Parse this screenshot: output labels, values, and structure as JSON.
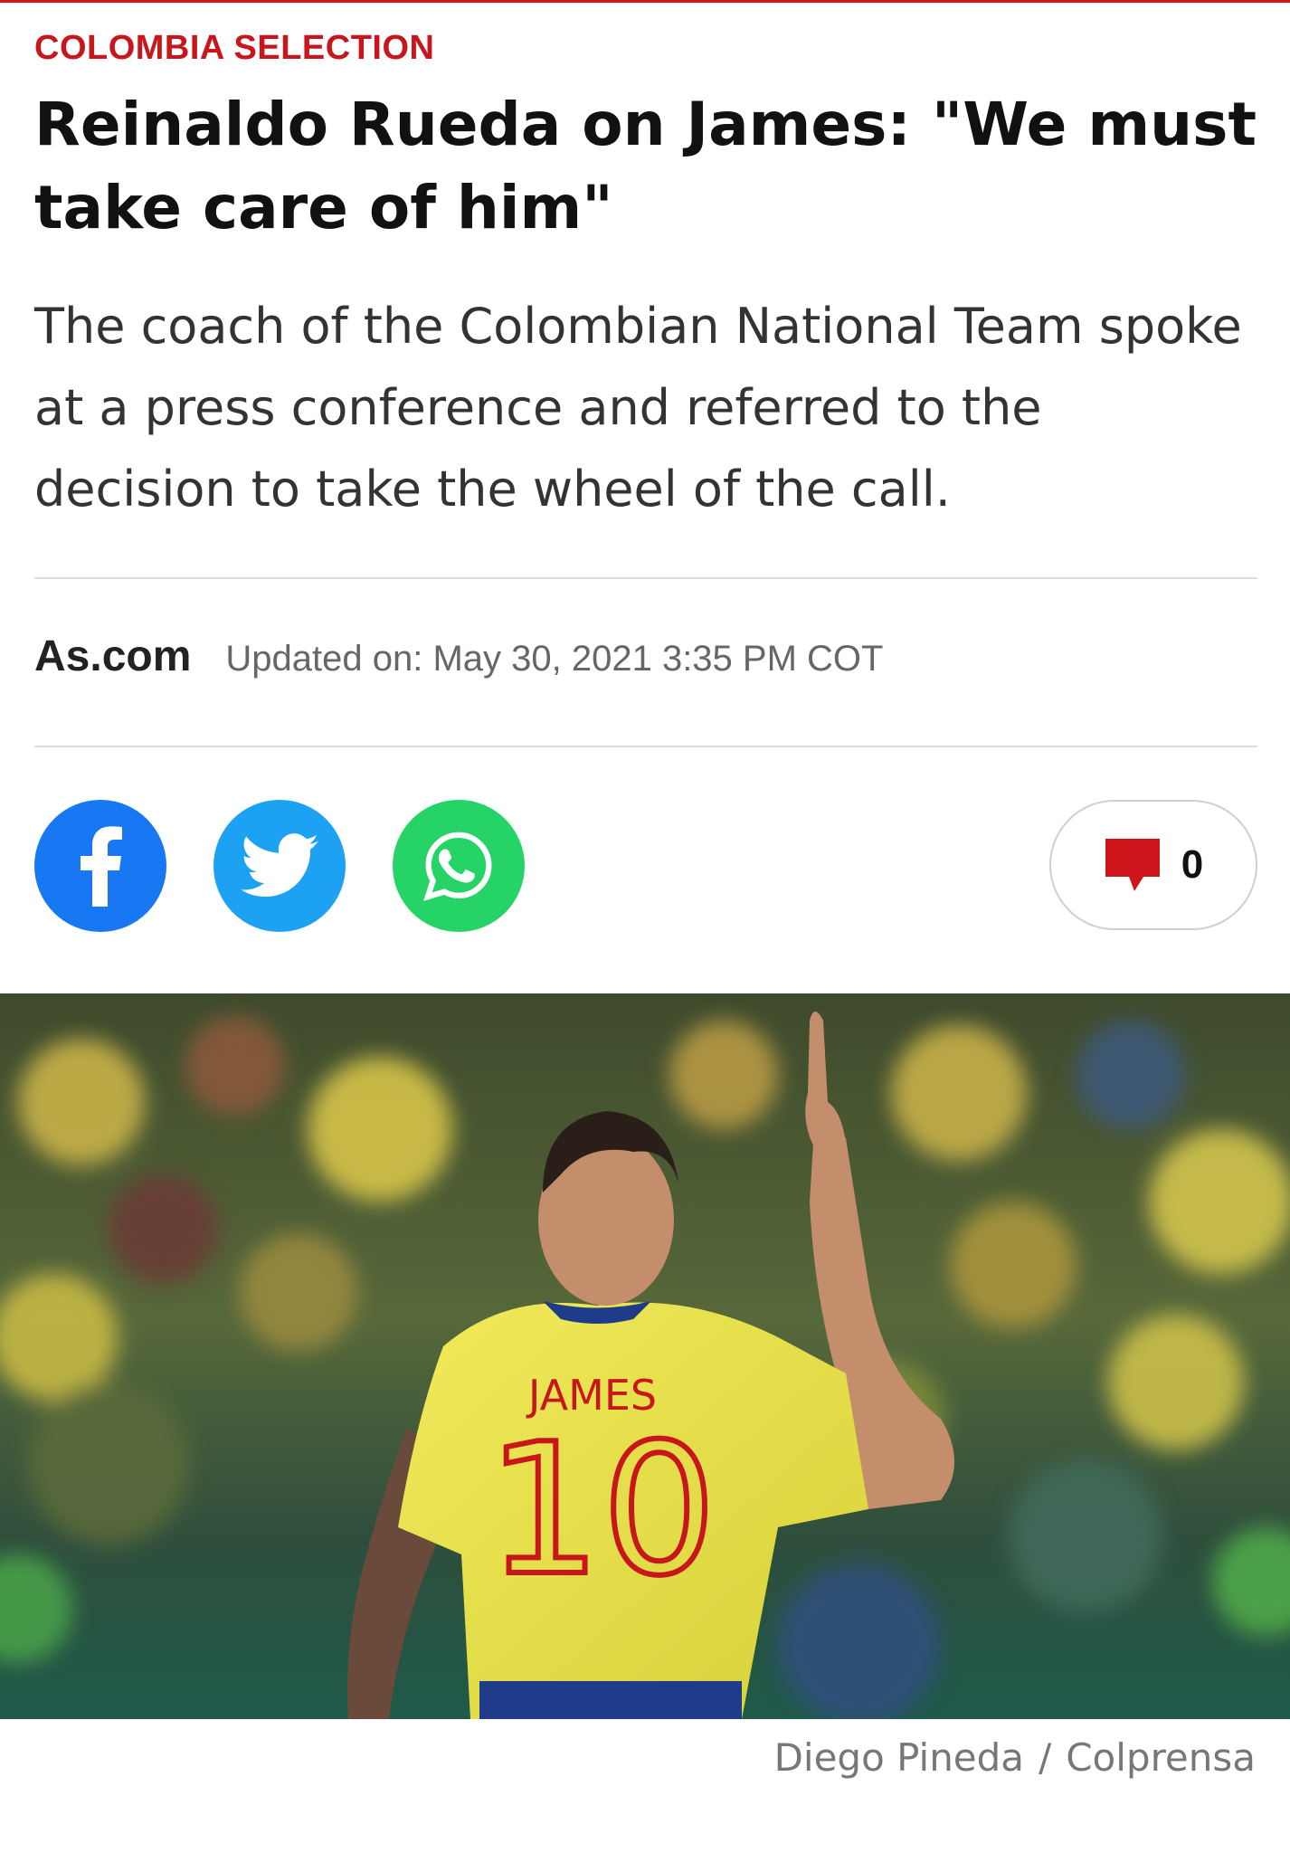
{
  "article": {
    "kicker": "COLOMBIA SELECTION",
    "title": "Reinaldo Rueda on James: \"We must take care of him\"",
    "subtitle": "The coach of the Colombian National Team spoke at a press conference and referred to the decision to take the wheel of the call.",
    "source": "As.com",
    "updated": "Updated on: May 30, 2021 3:35 PM COT"
  },
  "share": {
    "facebook": "facebook-icon",
    "twitter": "twitter-icon",
    "whatsapp": "whatsapp-icon",
    "comments_count": "0"
  },
  "photo": {
    "jersey_name": "JAMES",
    "jersey_number": "10",
    "credit_author": "Diego Pineda",
    "credit_separator": "/",
    "credit_agency": "Colprensa"
  },
  "colors": {
    "accent": "#c8161d",
    "facebook": "#1877f2",
    "twitter": "#1da1f2",
    "whatsapp": "#25d366",
    "jersey": "#e9e24a"
  }
}
